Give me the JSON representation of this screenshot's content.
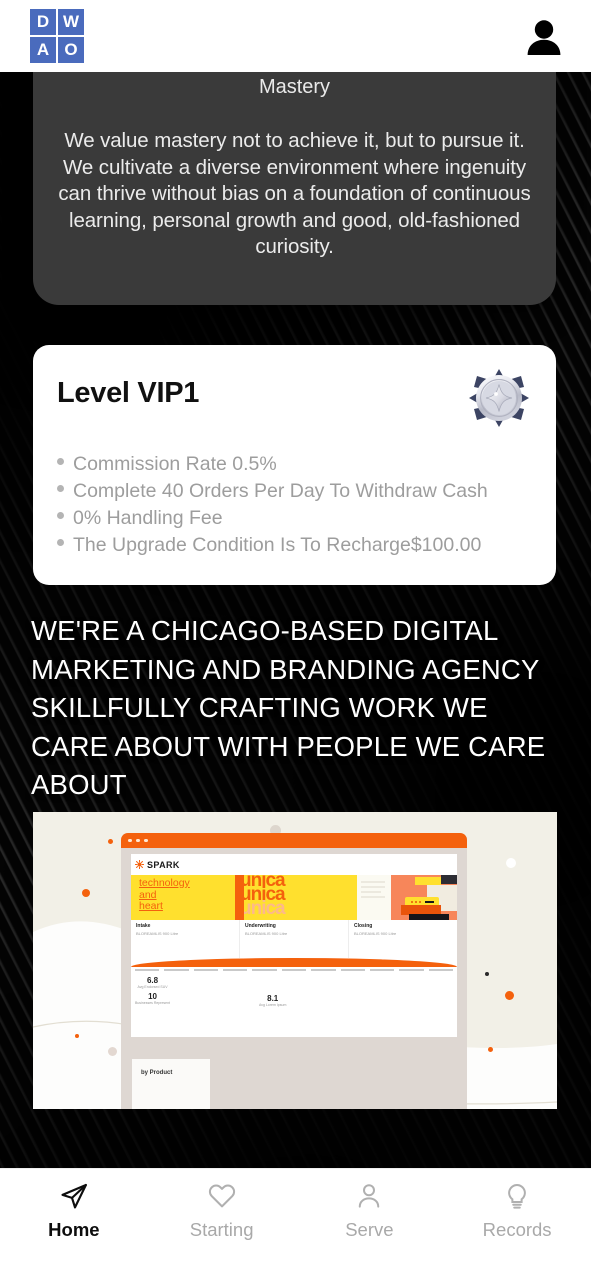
{
  "header": {
    "logo_letters": [
      "D",
      "W",
      "A",
      "O"
    ],
    "logo_color": "#4a6bbd",
    "avatar_icon": "user-avatar-icon"
  },
  "value_card": {
    "title": "Mastery",
    "body": "We value mastery not to achieve it, but to pursue it. We cultivate a diverse environment where ingenuity can thrive without bias on a foundation of continuous learning, personal growth and good, old-fashioned curiosity.",
    "background_color": "#3a3a3a"
  },
  "vip_card": {
    "level_label": "Level VIP1",
    "badge_icon": "vip-medal-icon",
    "benefits": [
      "Commission Rate 0.5%",
      "Complete 40 Orders Per Day To Withdraw Cash",
      "0% Handling Fee",
      "The Upgrade Condition Is To Recharge$100.00"
    ]
  },
  "headline": {
    "text": "WE'RE A CHICAGO-BASED DIGITAL MARKETING AND BRANDING AGENCY SKILLFULLY CRAFTING WORK WE CARE ABOUT WITH PEOPLE WE CARE ABOUT"
  },
  "portfolio_image": {
    "brand": "SPARK",
    "hero_lines": [
      "technology",
      "and",
      "heart"
    ],
    "wordmark_repeat": "unica",
    "cards": [
      {
        "title": "Intake",
        "sub": "BLOREAMLIS 900 Litre"
      },
      {
        "title": "Underwriting",
        "sub": "BLOREAMLIS 900 Litre"
      },
      {
        "title": "Closing",
        "sub": "BLOREAMLIS 900 Litre"
      }
    ],
    "stats": [
      {
        "value": "6.8",
        "label": "Avg Endorsed SUV"
      },
      {
        "value": "10",
        "label": "Businesses Represent"
      },
      {
        "value": "8.1",
        "label": "Avg Lorem Ipsum"
      }
    ],
    "footer_label": "by Product",
    "accent_color": "#f4610d",
    "yellow_color": "#ffe02e",
    "canvas_color": "#f2f0e7"
  },
  "tabbar": {
    "items": [
      {
        "label": "Home",
        "icon": "send-plane-icon",
        "active": true
      },
      {
        "label": "Starting",
        "icon": "heart-icon",
        "active": false
      },
      {
        "label": "Serve",
        "icon": "person-icon",
        "active": false
      },
      {
        "label": "Records",
        "icon": "lightbulb-icon",
        "active": false
      }
    ]
  }
}
